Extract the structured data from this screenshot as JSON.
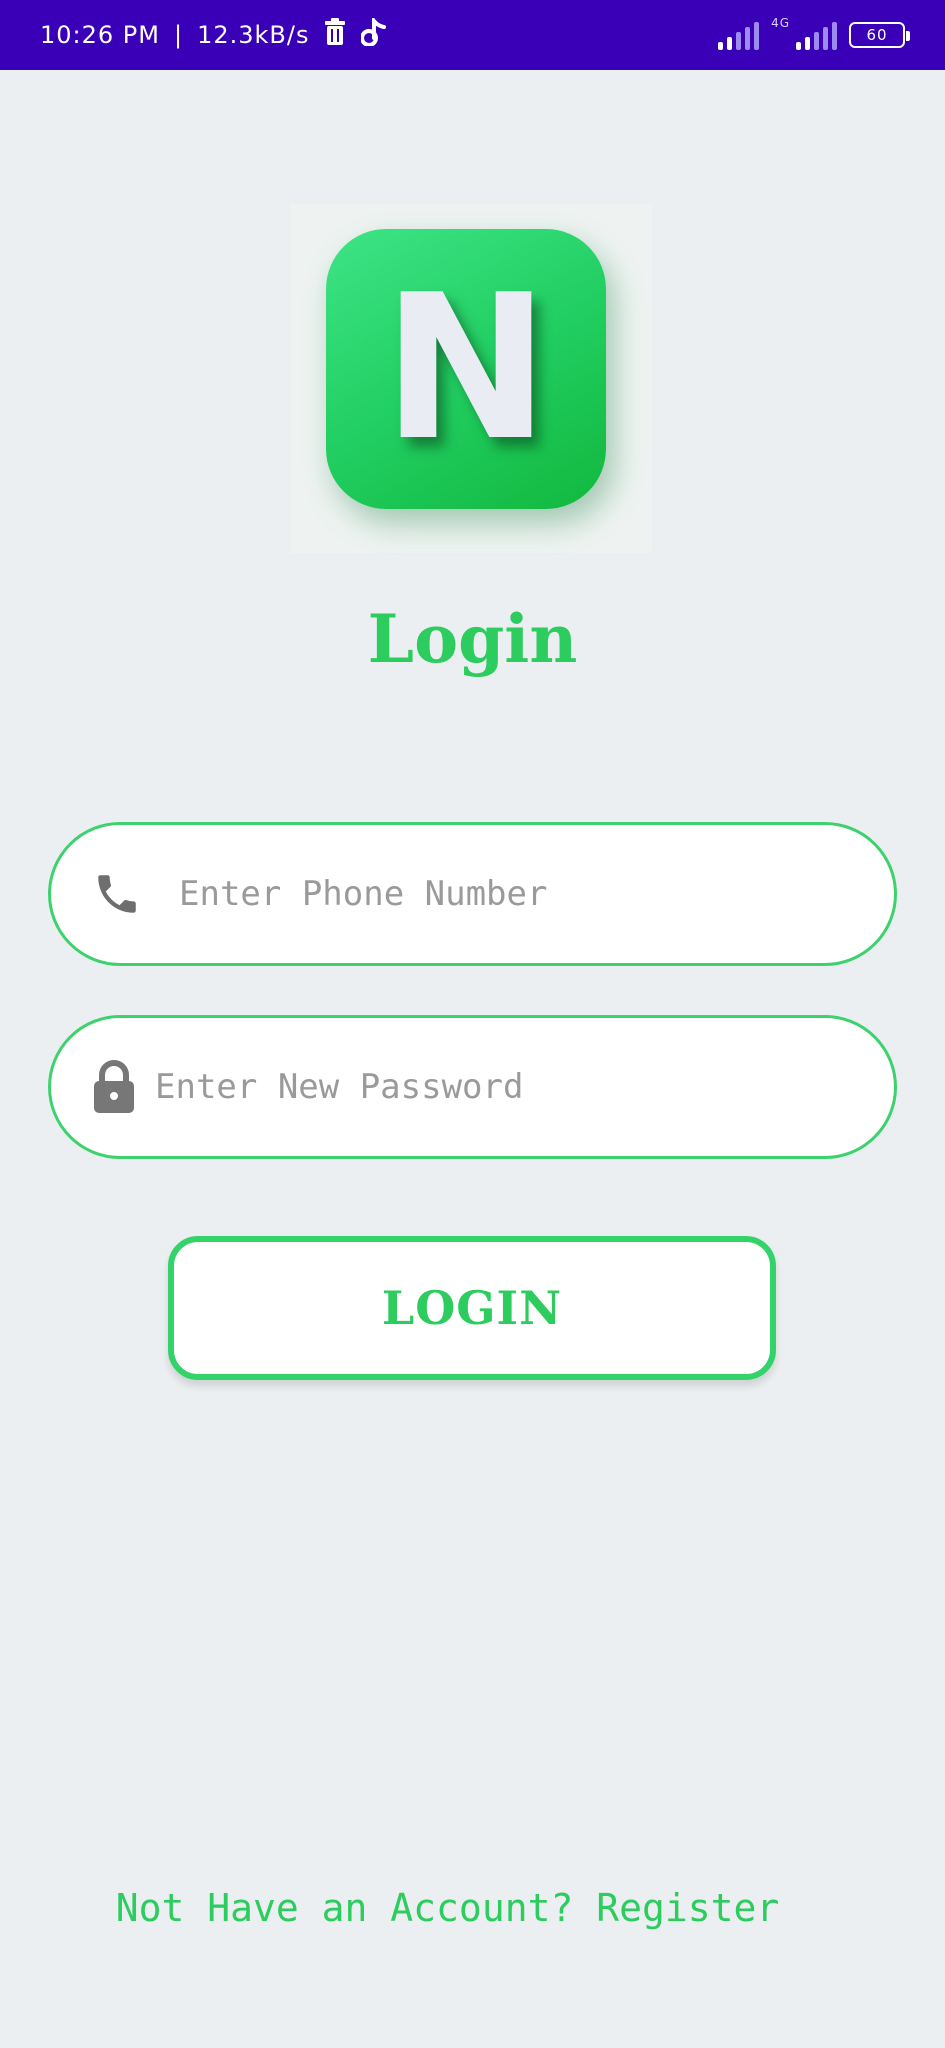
{
  "status_bar": {
    "time": "10:26 PM",
    "speed": "12.3kB/s",
    "network_type": "4G",
    "battery": "60"
  },
  "app": {
    "logo_letter": "N",
    "title": "Login"
  },
  "form": {
    "phone_placeholder": "Enter Phone Number",
    "password_placeholder": "Enter New Password",
    "login_label": "LOGIN"
  },
  "footer": {
    "register_text": "Not Have an Account? Register"
  },
  "colors": {
    "accent": "#2dcc5e",
    "status_bar": "#3a00b8",
    "background": "#eceff1"
  }
}
